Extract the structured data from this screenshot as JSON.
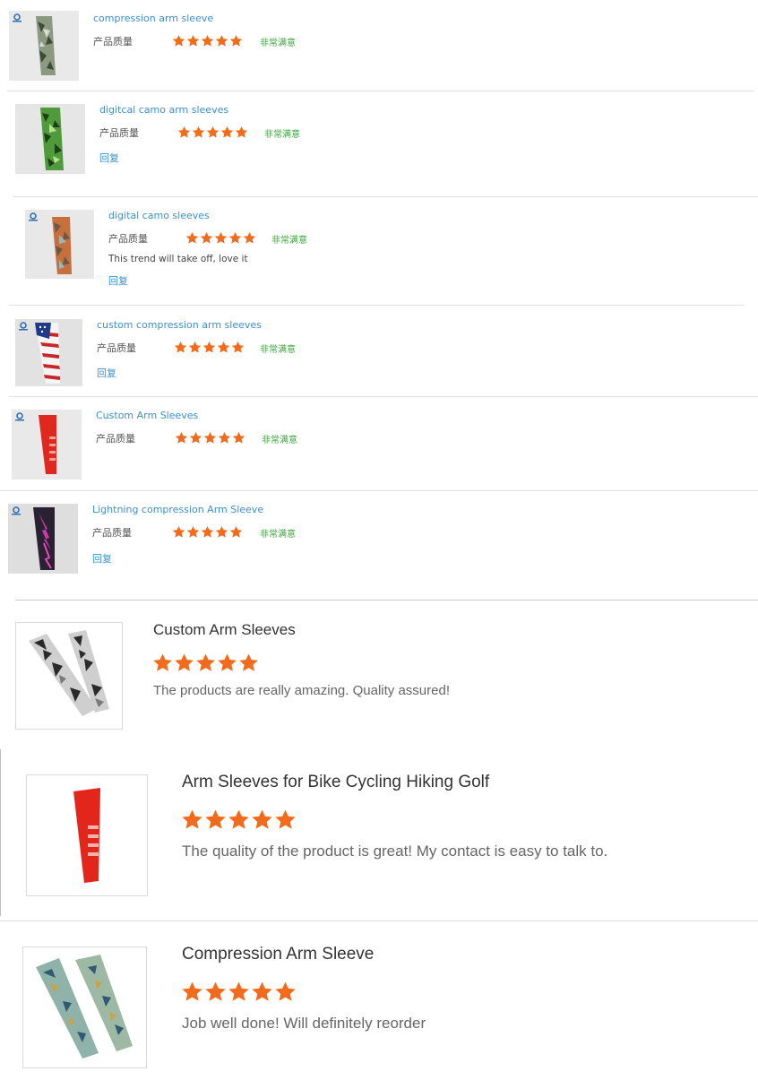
{
  "colors": {
    "link": "#3d8fcf",
    "star": "#f26a1b",
    "satisfied": "#3aa63a",
    "divider": "#e1e1e1"
  },
  "reviews_small": [
    {
      "title": "compression arm sleeve",
      "label": "产品质量",
      "rating": 5,
      "satisfaction": "非常满意",
      "comment": "",
      "reply": ""
    },
    {
      "title": "digitcal camo arm sleeves",
      "label": "产品质量",
      "rating": 5,
      "satisfaction": "非常满意",
      "comment": "",
      "reply": "回复"
    },
    {
      "title": "digital camo sleeves",
      "label": "产品质量",
      "rating": 5,
      "satisfaction": "非常满意",
      "comment": "This trend will take off, love it",
      "reply": "回复"
    },
    {
      "title": "custom compression arm sleeves",
      "label": "产品质量",
      "rating": 5,
      "satisfaction": "非常满意",
      "comment": "",
      "reply": "回复"
    },
    {
      "title": "Custom Arm Sleeves",
      "label": "产品质量",
      "rating": 5,
      "satisfaction": "非常满意",
      "comment": "",
      "reply": ""
    },
    {
      "title": "Lightning compression Arm Sleeve",
      "label": "产品质量",
      "rating": 5,
      "satisfaction": "非常满意",
      "comment": "",
      "reply": "回复"
    }
  ],
  "reviews_large": [
    {
      "title": "Custom Arm Sleeves",
      "rating": 5,
      "comment": "The products are really amazing. Quality assured!"
    },
    {
      "title": "Arm Sleeves for Bike Cycling Hiking Golf",
      "rating": 5,
      "comment": "The quality of the product is great! My contact is easy to talk to."
    },
    {
      "title": "Compression Arm Sleeve",
      "rating": 5,
      "comment": "Job well done! Will definitely reorder"
    }
  ]
}
